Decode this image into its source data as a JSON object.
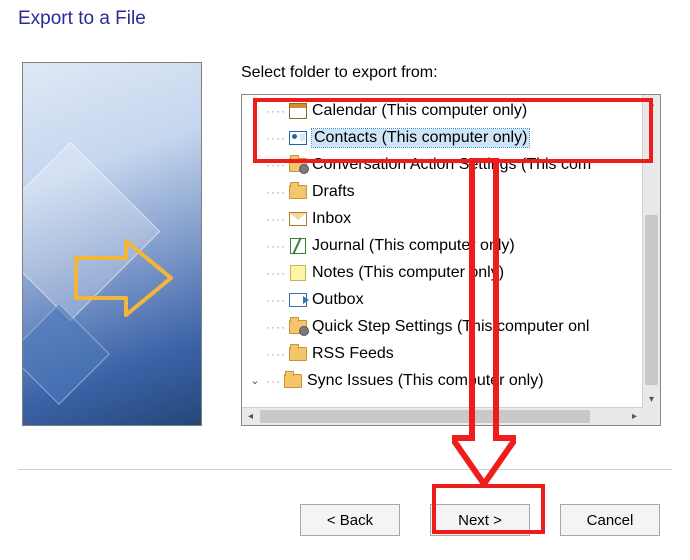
{
  "title": "Export to a File",
  "prompt": "Select folder to export from:",
  "tree": {
    "items": [
      {
        "label": "Calendar (This computer only)",
        "icon": "calendar-icon"
      },
      {
        "label": "Contacts (This computer only)",
        "icon": "contacts-icon",
        "selected": true
      },
      {
        "label": "Conversation Action Settings (This com",
        "icon": "folder-cog-icon"
      },
      {
        "label": "Drafts",
        "icon": "folder-icon"
      },
      {
        "label": "Inbox",
        "icon": "inbox-icon"
      },
      {
        "label": "Journal (This computer only)",
        "icon": "journal-icon"
      },
      {
        "label": "Notes (This computer only)",
        "icon": "notes-icon"
      },
      {
        "label": "Outbox",
        "icon": "outbox-icon"
      },
      {
        "label": "Quick Step Settings (This computer onl",
        "icon": "folder-cog-icon"
      },
      {
        "label": "RSS Feeds",
        "icon": "folder-icon"
      },
      {
        "label": "Sync Issues (This computer only)",
        "icon": "folder-icon",
        "expander": "v"
      }
    ]
  },
  "buttons": {
    "back": "<  Back",
    "next": "Next  >",
    "cancel": "Cancel"
  },
  "annotation": {
    "highlight_color": "#ef1c1c"
  }
}
